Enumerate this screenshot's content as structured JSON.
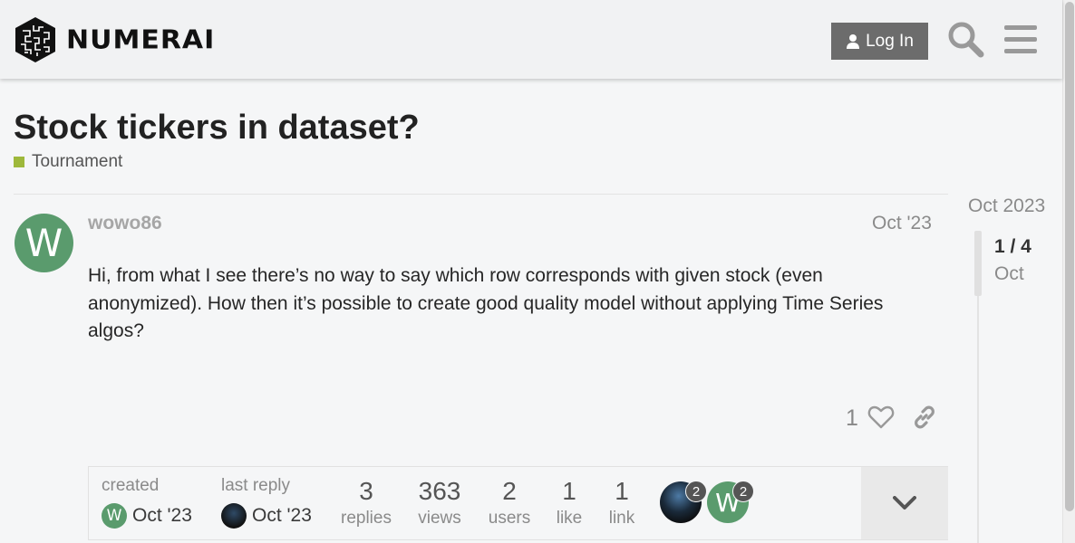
{
  "header": {
    "brand": "NUMERAI",
    "login_label": "Log In"
  },
  "topic": {
    "title": "Stock tickers in dataset?",
    "category": "Tournament",
    "category_color": "#9eb83b"
  },
  "post": {
    "avatar_letter": "W",
    "avatar_color": "#5a9b6d",
    "username": "wowo86",
    "date": "Oct '23",
    "body": "Hi, from what I see there’s no way to say which row corresponds with given stock (even anonymized). How then it’s possible to create good quality model without applying Time Series algos?",
    "like_count": "1"
  },
  "topic_map": {
    "created_label": "created",
    "created_date": "Oct '23",
    "last_reply_label": "last reply",
    "last_reply_date": "Oct '23",
    "stats": [
      {
        "num": "3",
        "label": "replies"
      },
      {
        "num": "363",
        "label": "views"
      },
      {
        "num": "2",
        "label": "users"
      },
      {
        "num": "1",
        "label": "like"
      },
      {
        "num": "1",
        "label": "link"
      }
    ],
    "participants": [
      {
        "count": "2"
      },
      {
        "letter": "W",
        "count": "2"
      }
    ]
  },
  "timeline": {
    "top_date": "Oct 2023",
    "position": "1 / 4",
    "current_date": "Oct"
  },
  "icons": [
    "numerai-logo-icon",
    "user-icon",
    "search-icon",
    "menu-icon",
    "heart-icon",
    "link-icon",
    "chevron-down-icon"
  ]
}
